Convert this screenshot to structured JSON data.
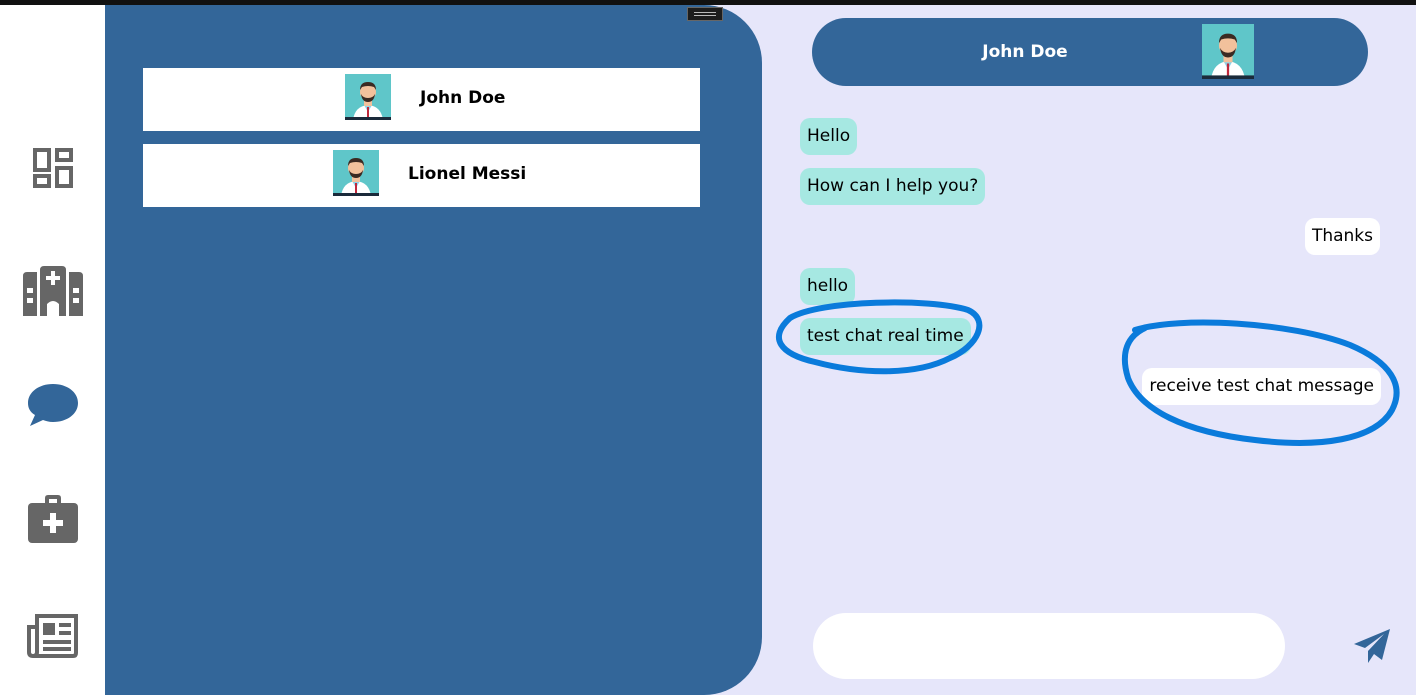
{
  "nav": [
    {
      "icon": "dashboard-icon"
    },
    {
      "icon": "hospital-icon"
    },
    {
      "icon": "chat-icon"
    },
    {
      "icon": "medical-kit-icon"
    },
    {
      "icon": "newspaper-icon"
    }
  ],
  "contacts": [
    {
      "name": "John Doe",
      "avatar": "doctor-avatar"
    },
    {
      "name": "Lionel Messi",
      "avatar": "doctor-avatar"
    }
  ],
  "chat": {
    "header_name": "John Doe",
    "messages": [
      {
        "text": "Hello",
        "direction": "received"
      },
      {
        "text": "How can I help you?",
        "direction": "received"
      },
      {
        "text": "Thanks",
        "direction": "sent"
      },
      {
        "text": "hello",
        "direction": "received"
      },
      {
        "text": "test chat real time",
        "direction": "received"
      },
      {
        "text": "receive test chat message",
        "direction": "sent"
      }
    ],
    "compose_placeholder": "",
    "send_icon": "send-icon"
  },
  "colors": {
    "primary": "#336699",
    "background": "#E6E6FA",
    "received_bubble": "#A6E8E2",
    "sent_bubble": "#FFFFFF",
    "annotation": "#0A7BDB",
    "icon_gray": "#666666"
  }
}
